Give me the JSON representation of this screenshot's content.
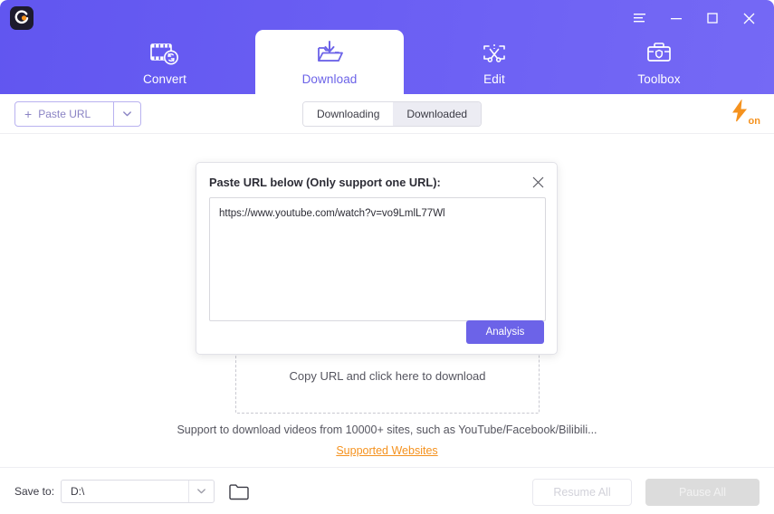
{
  "window": {
    "logo_icon": "app-logo-c",
    "controls": [
      {
        "name": "menu",
        "icon": "hamburger-icon"
      },
      {
        "name": "minimize",
        "icon": "minimize-icon"
      },
      {
        "name": "maximize",
        "icon": "maximize-icon"
      },
      {
        "name": "close",
        "icon": "close-icon"
      }
    ]
  },
  "tabs": [
    {
      "label": "Convert",
      "icon": "film-convert-icon",
      "active": false
    },
    {
      "label": "Download",
      "icon": "folder-download-icon",
      "active": true
    },
    {
      "label": "Edit",
      "icon": "scissors-edit-icon",
      "active": false
    },
    {
      "label": "Toolbox",
      "icon": "toolbox-icon",
      "active": false
    }
  ],
  "toolbar": {
    "paste_url_label": "Paste URL",
    "paste_url_plus": "+",
    "dropdown_icon": "chevron-down-icon",
    "segments": [
      {
        "label": "Downloading",
        "selected": false
      },
      {
        "label": "Downloaded",
        "selected": true
      }
    ],
    "boost_icon": "lightning-bolt-icon",
    "boost_state": "on"
  },
  "main": {
    "dropzone_text": "Copy URL and click here to download",
    "support_text": "Support to download videos from 10000+ sites, such as YouTube/Facebook/Bilibili...",
    "support_link": "Supported Websites"
  },
  "dialog": {
    "title": "Paste URL below (Only support one URL):",
    "close_icon": "close-icon",
    "url_value": "https://www.youtube.com/watch?v=vo9LmlL77Wl",
    "url_placeholder": "",
    "analysis_label": "Analysis"
  },
  "footer": {
    "save_to_label": "Save to:",
    "save_path": "D:\\",
    "save_dropdown_icon": "chevron-down-icon",
    "folder_icon": "folder-icon",
    "resume_all_label": "Resume All",
    "pause_all_label": "Pause All"
  },
  "colors": {
    "brand_purple": "#6c63e8",
    "header_purple": "#6a5ef3",
    "accent_orange": "#f5921e",
    "text_dark": "#2d2d36"
  }
}
